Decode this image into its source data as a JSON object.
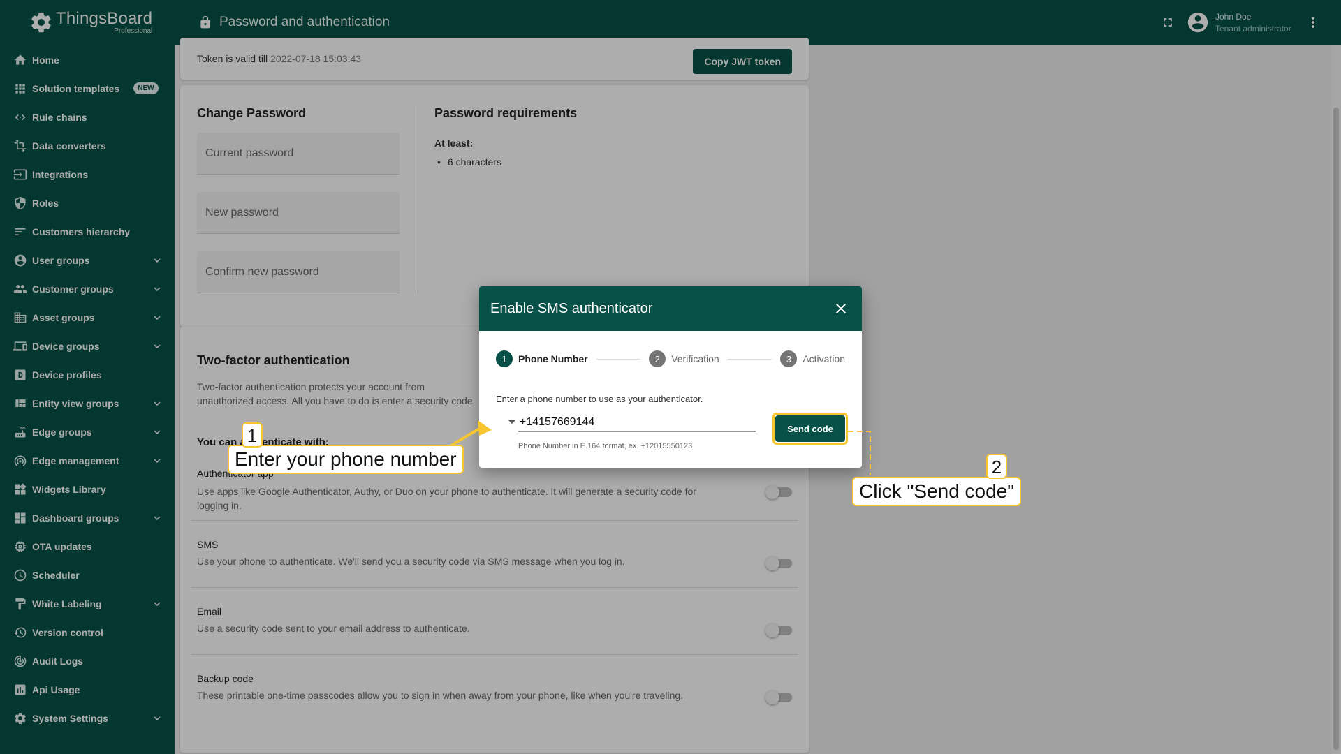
{
  "app": {
    "logo_name": "ThingsBoard",
    "logo_sub": "Professional",
    "page_title": "Password and authentication"
  },
  "user": {
    "name": "John Doe",
    "role": "Tenant administrator"
  },
  "sidebar": {
    "items": [
      {
        "label": "Home",
        "icon": "home-icon"
      },
      {
        "label": "Solution templates",
        "icon": "grid-icon",
        "badge": "NEW"
      },
      {
        "label": "Rule chains",
        "icon": "code-arrows-icon"
      },
      {
        "label": "Data converters",
        "icon": "transform-icon"
      },
      {
        "label": "Integrations",
        "icon": "input-icon"
      },
      {
        "label": "Roles",
        "icon": "shield-icon"
      },
      {
        "label": "Customers hierarchy",
        "icon": "sort-lines-icon"
      },
      {
        "label": "User groups",
        "icon": "account-circle-icon",
        "expandable": true
      },
      {
        "label": "Customer groups",
        "icon": "people-icon",
        "expandable": true
      },
      {
        "label": "Asset groups",
        "icon": "domain-icon",
        "expandable": true
      },
      {
        "label": "Device groups",
        "icon": "devices-icon",
        "expandable": true
      },
      {
        "label": "Device profiles",
        "icon": "device-profile-icon"
      },
      {
        "label": "Entity view groups",
        "icon": "view-quilt-icon",
        "expandable": true
      },
      {
        "label": "Edge groups",
        "icon": "router-icon",
        "expandable": true
      },
      {
        "label": "Edge management",
        "icon": "wifi-tethering-icon",
        "expandable": true
      },
      {
        "label": "Widgets Library",
        "icon": "widgets-icon"
      },
      {
        "label": "Dashboard groups",
        "icon": "dashboard-icon",
        "expandable": true
      },
      {
        "label": "OTA updates",
        "icon": "memory-icon"
      },
      {
        "label": "Scheduler",
        "icon": "schedule-icon"
      },
      {
        "label": "White Labeling",
        "icon": "format-paint-icon",
        "expandable": true
      },
      {
        "label": "Version control",
        "icon": "history-icon"
      },
      {
        "label": "Audit Logs",
        "icon": "track-changes-icon"
      },
      {
        "label": "Api Usage",
        "icon": "insert-chart-icon"
      },
      {
        "label": "System Settings",
        "icon": "settings-icon",
        "expandable": true
      }
    ]
  },
  "token": {
    "prefix": "Token is valid till",
    "date": "2022-07-18 15:03:43",
    "copy_label": "Copy JWT token"
  },
  "change_password": {
    "title": "Change Password",
    "current_placeholder": "Current password",
    "new_placeholder": "New password",
    "confirm_placeholder": "Confirm new password",
    "req_title": "Password requirements",
    "req_at_least": "At least:",
    "req_items": [
      "6 characters"
    ]
  },
  "two_factor": {
    "title": "Two-factor authentication",
    "description": "Two-factor authentication protects your account from unauthorized access. All you have to do is enter a security code when you log in.",
    "subtitle": "You can authenticate with:",
    "options": [
      {
        "title": "Authenticator app",
        "description": "Use apps like Google Authenticator, Authy, or Duo on your phone to authenticate. It will generate a security code for logging in."
      },
      {
        "title": "SMS",
        "description": "Use your phone to authenticate. We'll send you a security code via SMS message when you log in."
      },
      {
        "title": "Email",
        "description": "Use a security code sent to your email address to authenticate."
      },
      {
        "title": "Backup code",
        "description": "These printable one-time passcodes allow you to sign in when away from your phone, like when you're traveling."
      }
    ]
  },
  "dialog": {
    "title": "Enable SMS authenticator",
    "steps": [
      {
        "num": "1",
        "label": "Phone Number"
      },
      {
        "num": "2",
        "label": "Verification"
      },
      {
        "num": "3",
        "label": "Activation"
      }
    ],
    "instruction": "Enter a phone number to use as your authenticator.",
    "phone_value": "+14157669144",
    "phone_hint": "Phone Number in E.164 format, ex. +12015550123",
    "send_label": "Send code"
  },
  "annotations": [
    {
      "num": "1",
      "text": "Enter your phone number"
    },
    {
      "num": "2",
      "text": "Click \"Send code\""
    }
  ],
  "colors": {
    "primary": "#075148",
    "highlight": "#f7c62f"
  }
}
